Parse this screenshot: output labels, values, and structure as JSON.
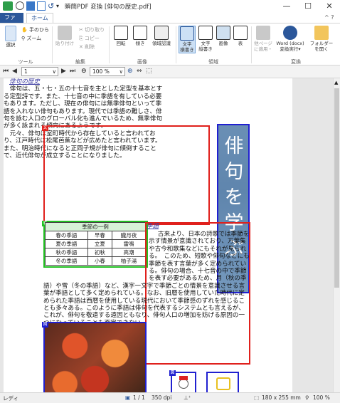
{
  "window": {
    "title": "瞬簡PDF 変換 [俳句の歴史.pdf]",
    "min": "—",
    "max": "☐",
    "close": "✕"
  },
  "tabs": {
    "file": "ファイル",
    "home": "ホーム"
  },
  "ribbon": {
    "tool": {
      "select": "選択",
      "hand": "手のひら",
      "zoom": "ズーム",
      "label": "ツール"
    },
    "edit": {
      "paste": "貼り付け",
      "cut": "切り取り",
      "copy": "コピー",
      "delete": "削除",
      "label": "編集"
    },
    "image": {
      "rotate": "回転",
      "tilt": "傾き",
      "region": "領域認識",
      "label": "画像"
    },
    "region": {
      "text_h_1": "文字",
      "text_h_2": "横書き",
      "text_v_1": "文字",
      "text_v_2": "縦書き",
      "picture": "画像",
      "table": "表",
      "label": "領域"
    },
    "convert": {
      "other_1": "他ページ",
      "other_2": "に適用・",
      "word_1": "Word (docx)",
      "word_2": "変換実行▾",
      "folder_1": "フォルダー",
      "folder_2": "を開く",
      "label": "変換"
    }
  },
  "nav": {
    "page": "1",
    "zoom": "100 %"
  },
  "status": {
    "ready": "レディ",
    "pages": "1 / 1",
    "dpi": "350 dpi",
    "size": "180 x 255 mm",
    "zoom": "100 %"
  },
  "document": {
    "title": "俳句の歴史",
    "para1": "俳句は、五・七・五の十七音を主とした定型を基本とする定型詩です。また、十七音の中に季語を有している必要もあります。ただし、現在の俳句には無季俳句といって季語を入れない俳句もあります。現代では季語の難しさ、俳句を詠む人口のグローバル化も進んでいるため、無季俳句が多く詠まれる傾向にあるようです。",
    "para2": "元々、俳句は室町時代から存在していると言われており、江戸時代に松尾芭蕉などが広めたと言われています。また、明治時代になると正岡子規が俳句に傾倒することで、近代俳句が成立することになりました。",
    "vertical": "俳句を学ぶ",
    "table_title": "季節の一例",
    "table_rows": [
      [
        "春の季語",
        "早春",
        "朧月夜"
      ],
      [
        "夏の季語",
        "立夏",
        "雷鳴"
      ],
      [
        "秋の季語",
        "初秋",
        "高潮"
      ],
      [
        "冬の季語",
        "小春",
        "柚子湯"
      ]
    ],
    "kigo_title": "季語",
    "kigo_para": "古来より、日本の詩歌では季節を示す情景が意識されており、万葉集や古今和歌集などにもそれが見られる。　このため、短歌や俳句などにも季節を表す言葉が多く定められている。俳句の場合、十七音の中で季節を表す必要があるため、月（秋の季語）や雪（冬の季語）など、漢字一文字で季節ごとの情景を意識させる言葉が季語として多く定められている。なお、旧暦を使用していた時代に定められた季語は西暦を使用している現代において季節感のずれを感じることも多々ある。このように季語は俳句を代表するシステムとも言えるが、これが、俳句を敬遠する遠因ともなり、俳句人口の増加を妨げる原因の一つになっていることも否定できない。"
  }
}
